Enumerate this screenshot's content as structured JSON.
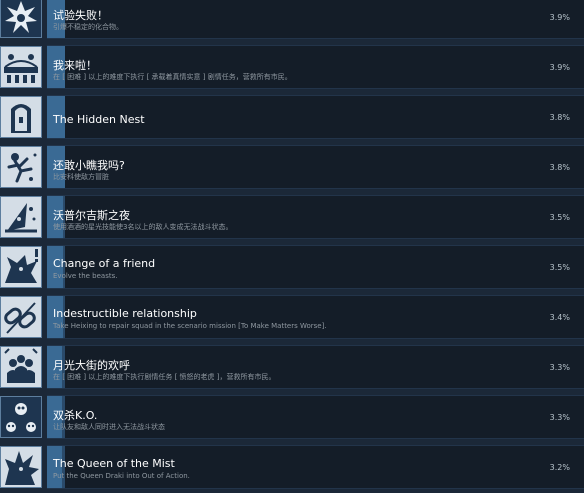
{
  "achievements": [
    {
      "icon": "blast-icon",
      "title": "试验失败！",
      "desc": "引爆不稳定的化合物。",
      "percent": "3.9%",
      "fill": 0.039
    },
    {
      "icon": "city-icon",
      "title": "我来啦！",
      "desc": "在 [ 困难 ] 以上的难度下执行 [ 承载着真情实意 ] 剧情任务，营救所有市民。",
      "percent": "3.9%",
      "fill": 0.039
    },
    {
      "icon": "door-icon",
      "title": "The Hidden Nest",
      "desc": "",
      "percent": "3.8%",
      "fill": 0.038
    },
    {
      "icon": "falling-figure-icon",
      "title": "还敢小瞧我吗?",
      "desc": "比安科使敌方冒脏",
      "percent": "3.8%",
      "fill": 0.038
    },
    {
      "icon": "wizard-hat-icon",
      "title": "沃普尔吉斯之夜",
      "desc": "使用酒酒的星光技能使3名以上的敌人变成无法战斗状态。",
      "percent": "3.5%",
      "fill": 0.035
    },
    {
      "icon": "beast-icon",
      "title": "Change of a friend",
      "desc": "Evolve the beasts.",
      "percent": "3.5%",
      "fill": 0.035
    },
    {
      "icon": "chain-icon",
      "title": "Indestructible relationship",
      "desc": "Take Heixing to repair squad in the scenario mission [To Make Matters Worse].",
      "percent": "3.4%",
      "fill": 0.034
    },
    {
      "icon": "crowd-icon",
      "title": "月光大街的欢呼",
      "desc": "在 [ 困难 ] 以上的难度下执行剧情任务 [ 愤怒的老虎 ]，营救所有市民。",
      "percent": "3.3%",
      "fill": 0.033
    },
    {
      "icon": "skull-icon",
      "title": "双杀K.O.",
      "desc": "让队友和敌人同时进入无法战斗状态",
      "percent": "3.3%",
      "fill": 0.033
    },
    {
      "icon": "dragon-icon",
      "title": "The Queen of the Mist",
      "desc": "Put the Queen Draki into Out of Action.",
      "percent": "3.2%",
      "fill": 0.032
    }
  ]
}
